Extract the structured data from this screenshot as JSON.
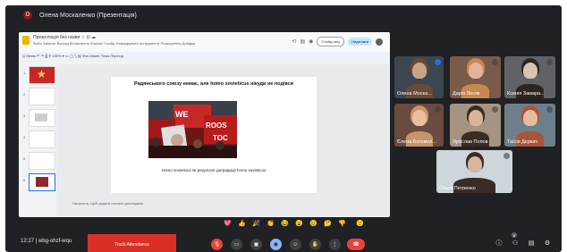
{
  "header": {
    "presenter_label": "Олена Москаленко (Презентація)",
    "presenter_initial": "О"
  },
  "slides": {
    "doc_title": "Презентація без назви ☆ ⊡ ☁",
    "menu": "Файл  Змінити  Вигляд  Вставлення  Формат  Слайд  Упорядкувати  Інструменти  Розширення  Довідка",
    "slideshow_label": "Слайд-шоу",
    "share_label": "Надіслати",
    "toolbar": "Q  Меню  ↶  ↷  ⎙  ⚲  100%  ▾  ▭  ◯  ╲  ▤  Фон  Макет  Тема  Перехід",
    "slide_title": "Радянського союзу немає, але homo sovieticus нікуди не подівся",
    "slide_caption": "Homo sovieticus як результат деградації homo sovieticus",
    "photo_text_1": "WE",
    "photo_text_2": "ROOS",
    "photo_text_3": "TOC",
    "notes": "Натисніть, щоб додати нотатки доповідача",
    "thumb_numbers": [
      "1",
      "2",
      "3",
      "4",
      "5",
      "6"
    ]
  },
  "participants": [
    {
      "name": "Олена Моска...",
      "bg": "#3c4650",
      "skin": "#c9a48a",
      "hair": "#6b4a32",
      "mic": "speaking"
    },
    {
      "name": "Дарія Лисяк",
      "bg": "#7a5a48",
      "skin": "#e0b49a",
      "hair": "#c7884f"
    },
    {
      "name": "Ксенія Замара...",
      "bg": "#5f6368",
      "skin": "#d8c3b0",
      "hair": "#2d2420"
    },
    {
      "name": "Єлена Богомол...",
      "bg": "#6a4b3f",
      "skin": "#e7c0a3",
      "hair": "#c79468"
    },
    {
      "name": "Ярослав Попов",
      "bg": "#a59482",
      "skin": "#d9b39a",
      "hair": "#3b2b22"
    },
    {
      "name": "Таїсія Дєркач",
      "bg": "#6e7f8c",
      "skin": "#e4bca0",
      "hair": "#a9553a"
    },
    {
      "name": "Ольга Петренко",
      "bg": "#cdd6da",
      "skin": "#d6b6a0",
      "hair": "#3a2b24"
    }
  ],
  "reactions": [
    "💖",
    "👍",
    "🎉",
    "👏",
    "😂",
    "😮",
    "😢",
    "🤔",
    "👎",
    "🙂"
  ],
  "bottom": {
    "time": "12:27  |  wbg-ohzf-wqu",
    "attendance_label": "Track Attendance",
    "participant_count": "6",
    "info_icon": "ⓘ",
    "people_icon": "⚇",
    "chat_icon": "▤",
    "activities_icon": "⚙"
  },
  "colors": {
    "meet_bg": "#202124",
    "end_call": "#ea4335",
    "attendance": "#d93025",
    "present_active": "#8ab4f8"
  }
}
